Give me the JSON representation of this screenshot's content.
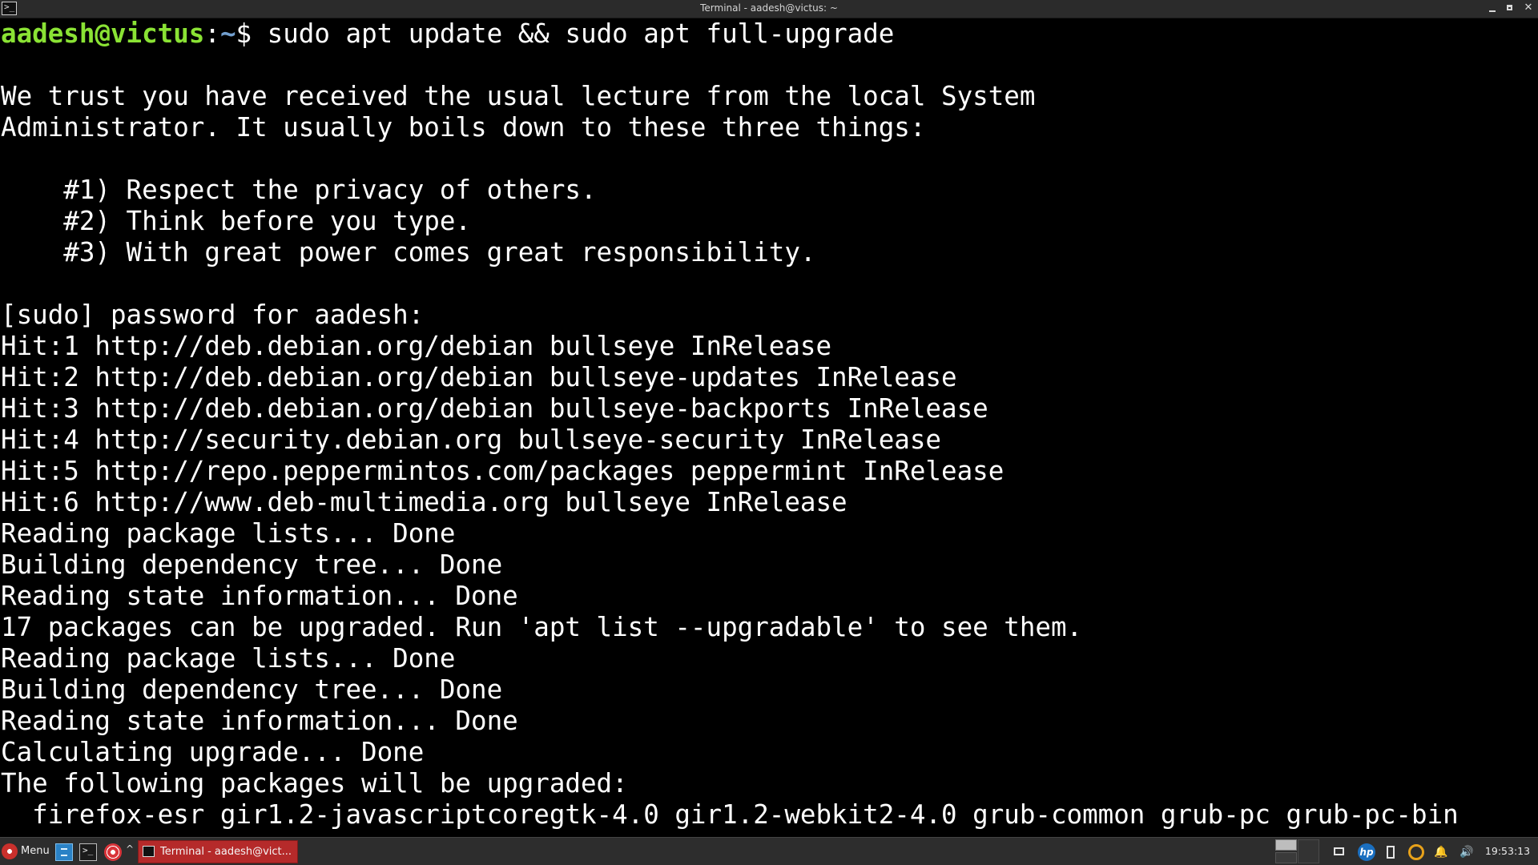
{
  "window": {
    "title": "Terminal - aadesh@victus: ~",
    "app_icon_glyph": ">_",
    "minimize_glyph": "",
    "close_glyph": "✕"
  },
  "terminal": {
    "prompt": {
      "user_host": "aadesh@victus",
      "colon": ":",
      "path": "~",
      "dollar": "$",
      "command": " sudo apt update && sudo apt full-upgrade"
    },
    "lines": [
      "",
      "We trust you have received the usual lecture from the local System",
      "Administrator. It usually boils down to these three things:",
      "",
      "    #1) Respect the privacy of others.",
      "    #2) Think before you type.",
      "    #3) With great power comes great responsibility.",
      "",
      "[sudo] password for aadesh:",
      "Hit:1 http://deb.debian.org/debian bullseye InRelease",
      "Hit:2 http://deb.debian.org/debian bullseye-updates InRelease",
      "Hit:3 http://deb.debian.org/debian bullseye-backports InRelease",
      "Hit:4 http://security.debian.org bullseye-security InRelease",
      "Hit:5 http://repo.peppermintos.com/packages peppermint InRelease",
      "Hit:6 http://www.deb-multimedia.org bullseye InRelease",
      "Reading package lists... Done",
      "Building dependency tree... Done",
      "Reading state information... Done",
      "17 packages can be upgraded. Run 'apt list --upgradable' to see them.",
      "Reading package lists... Done",
      "Building dependency tree... Done",
      "Reading state information... Done",
      "Calculating upgrade... Done",
      "The following packages will be upgraded:",
      "  firefox-esr gir1.2-javascriptcoregtk-4.0 gir1.2-webkit2-4.0 grub-common grub-pc grub-pc-bin"
    ],
    "colors": {
      "background": "#000000",
      "foreground": "#ffffff",
      "prompt_user": "#8ae234",
      "prompt_path": "#729fcf"
    }
  },
  "taskbar": {
    "menu_label": "Menu",
    "term_launcher_glyph": ">_",
    "tray_arrow": "^",
    "task_item_label": "Terminal - aadesh@vict...",
    "hp_label": "hp",
    "bell_glyph": "🔔",
    "volume_glyph": "🔊",
    "clock": "19:53:13",
    "accent_color": "#b52a2a"
  }
}
